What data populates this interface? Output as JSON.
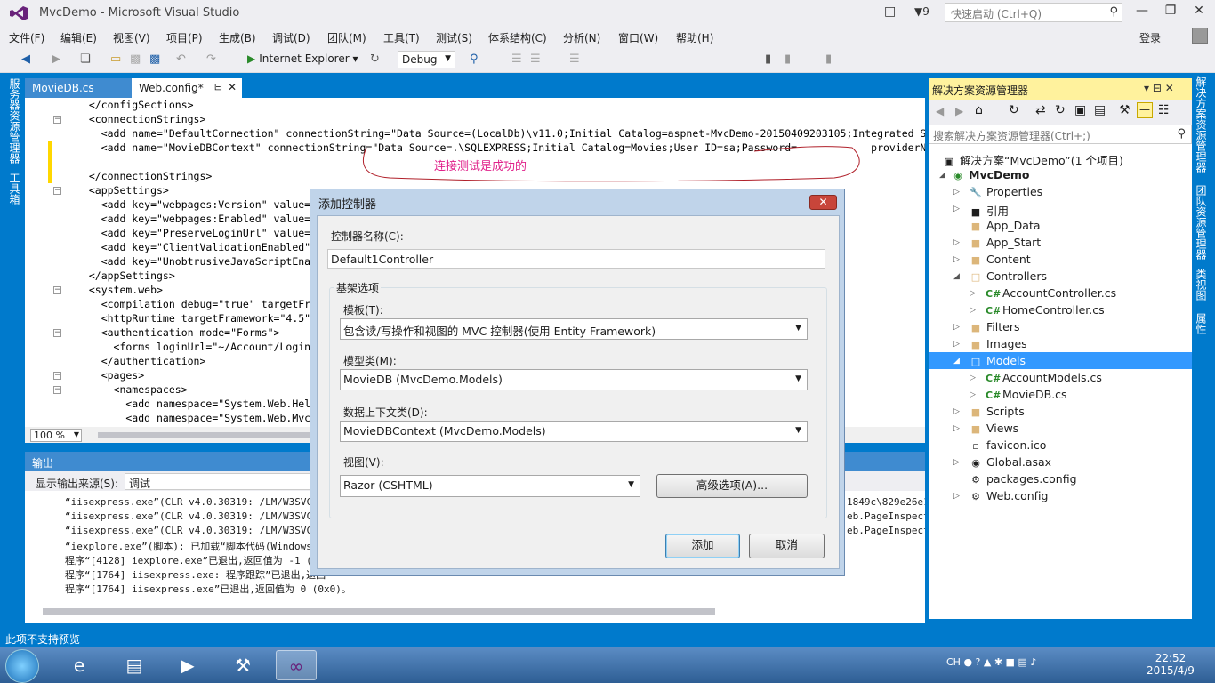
{
  "window": {
    "title": "MvcDemo - Microsoft Visual Studio",
    "notif_count": "9",
    "quick_launch": "快速启动 (Ctrl+Q)",
    "login": "登录"
  },
  "menu": [
    "文件(F)",
    "编辑(E)",
    "视图(V)",
    "项目(P)",
    "生成(B)",
    "调试(D)",
    "团队(M)",
    "工具(T)",
    "测试(S)",
    "体系结构(C)",
    "分析(N)",
    "窗口(W)",
    "帮助(H)"
  ],
  "toolbar": {
    "run_label": "Internet Explorer",
    "config": "Debug"
  },
  "left_tabs": [
    "服务器资源管理器",
    "工具箱"
  ],
  "right_tabs": [
    "团队资源管理器",
    "类视图",
    "属性"
  ],
  "doc_tabs": [
    "MovieDB.cs",
    "Web.config*"
  ],
  "editor": {
    "lines": [
      "  </configSections>",
      "  <connectionStrings>",
      "    <add name=\"DefaultConnection\" connectionString=\"Data Source=(LocalDb)\\v11.0;Initial Catalog=aspnet-MvcDemo-20150409203105;Integrated Se",
      "    <add name=\"MovieDBContext\" connectionString=\"Data Source=.\\SQLEXPRESS;Initial Catalog=Movies;User ID=sa;Password=            providerNa",
      "",
      "  </connectionStrings>",
      "  <appSettings>",
      "    <add key=\"webpages:Version\" value=\"2",
      "    <add key=\"webpages:Enabled\" value=\"f",
      "    <add key=\"PreserveLoginUrl\" value=\"t",
      "    <add key=\"ClientValidationEnabled\" v",
      "    <add key=\"UnobtrusiveJavaScriptEnabl",
      "  </appSettings>",
      "  <system.web>",
      "    <compilation debug=\"true\" targetFram",
      "    <httpRuntime targetFramework=\"4.5\" /",
      "    <authentication mode=\"Forms\">",
      "      <forms loginUrl=\"~/Account/Login\"",
      "    </authentication>",
      "    <pages>",
      "      <namespaces>",
      "        <add namespace=\"System.Web.Helpe",
      "        <add namespace=\"System.Web.Mvc\""
    ],
    "annotation": "连接测试是成功的",
    "zoom": "100 %"
  },
  "output": {
    "title": "输出",
    "source_label": "显示输出来源(S):",
    "source_value": "调试",
    "lines": [
      "“iisexpress.exe”(CLR v4.0.30319: /LM/W3SVC/2/ROOT",
      "“iisexpress.exe”(CLR v4.0.30319: /LM/W3SVC/2/ROOT",
      "“iisexpress.exe”(CLR v4.0.30319: /LM/W3SVC/2/ROOT",
      "“iexplore.exe”(脚本): 已加载“脚本代码(Windows I",
      "程序“[4128] iexplore.exe”已退出,返回值为 -1 (0x",
      "程序“[1764] iisexpress.exe: 程序跟踪”已退出,返回",
      "程序“[1764] iisexpress.exe”已退出,返回值为 0 (0x0)。"
    ],
    "right_fragments": [
      "1849c\\829e26e1\\",
      "eb.PageInspecto",
      "eb.PageInspecto"
    ]
  },
  "solution_explorer": {
    "title": "解决方案资源管理器",
    "search": "搜索解决方案资源管理器(Ctrl+;)",
    "solution": "解决方案“MvcDemo”(1 个项目)",
    "project": "MvcDemo",
    "items": [
      "Properties",
      "引用",
      "App_Data",
      "App_Start",
      "Content",
      "Controllers",
      "AccountController.cs",
      "HomeController.cs",
      "Filters",
      "Images",
      "Models",
      "AccountModels.cs",
      "MovieDB.cs",
      "Scripts",
      "Views",
      "favicon.ico",
      "Global.asax",
      "packages.config",
      "Web.config"
    ]
  },
  "status": "此项不支持预览",
  "dialog": {
    "title": "添加控制器",
    "name_label": "控制器名称(C):",
    "name_value": "Default1Controller",
    "group_label": "基架选项",
    "template_label": "模板(T):",
    "template_value": "包含读/写操作和视图的 MVC 控制器(使用 Entity Framework)",
    "model_label": "模型类(M):",
    "model_value": "MovieDB (MvcDemo.Models)",
    "context_label": "数据上下文类(D):",
    "context_value": "MovieDBContext (MvcDemo.Models)",
    "view_label": "视图(V):",
    "view_value": "Razor (CSHTML)",
    "advanced_button": "高级选项(A)...",
    "add_button": "添加",
    "cancel_button": "取消"
  },
  "taskbar": {
    "lang": "CH",
    "time": "22:52",
    "date": "2015/4/9"
  }
}
